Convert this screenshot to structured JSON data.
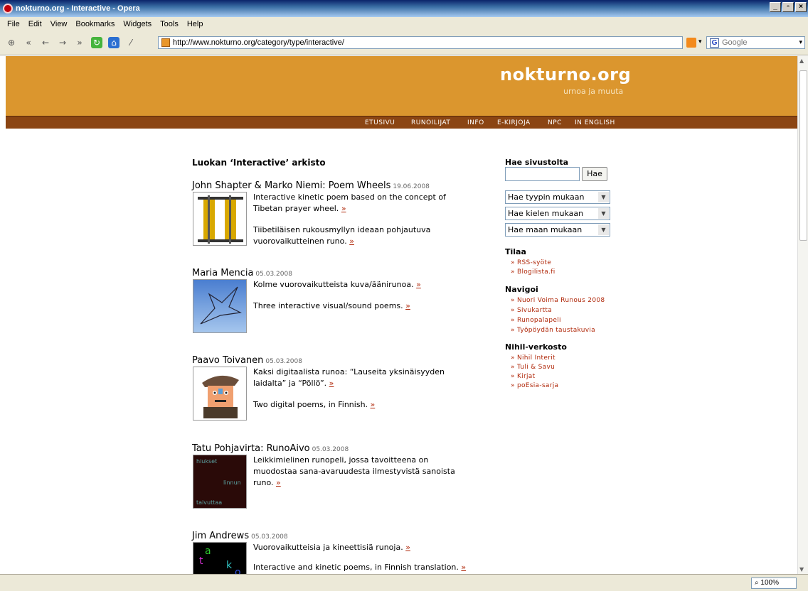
{
  "window": {
    "title": "nokturno.org - Interactive - Opera"
  },
  "menubar": {
    "items": [
      "File",
      "Edit",
      "View",
      "Bookmarks",
      "Widgets",
      "Tools",
      "Help"
    ]
  },
  "toolbar": {
    "url": "http://www.nokturno.org/category/type/interactive/",
    "search_placeholder": "Google"
  },
  "statusbar": {
    "zoom": "100%"
  },
  "site": {
    "name": "nokturno.org",
    "tagline": "urnoa ja muuta",
    "nav": [
      "ETUSIVU",
      "RUNOILIJAT",
      "INFO",
      "E-KIRJOJA",
      "NPC",
      "IN ENGLISH"
    ]
  },
  "archive": {
    "title": "Luokan ‘Interactive’ arkisto"
  },
  "posts": [
    {
      "title": "John Shapter & Marko Niemi: Poem Wheels",
      "date": "19.06.2008",
      "text1": "Interactive kinetic poem based on the concept of Tibetan prayer wheel.",
      "text2": "Tiibetiläisen rukousmyllyn ideaan pohjautuva vuorovaikutteinen runo."
    },
    {
      "title": "Maria Mencia",
      "date": "05.03.2008",
      "text1": "Kolme vuorovaikutteista kuva/äänirunoa.",
      "text2": "Three interactive visual/sound poems."
    },
    {
      "title": "Paavo Toivanen",
      "date": "05.03.2008",
      "text1": "Kaksi digitaalista runoa: “Lauseita yksinäisyyden laidalta” ja “Pöllö”.",
      "text2": "Two digital poems, in Finnish."
    },
    {
      "title": "Tatu Pohjavirta: RunoAivo",
      "date": "05.03.2008",
      "text1": "Leikkimielinen runopeli, jossa tavoitteena on muodostaa sana-avaruudesta ilmestyvistä sanoista runo.",
      "thumb_words": [
        "hiukset",
        "linnun",
        "taivuttaa"
      ]
    },
    {
      "title": "Jim Andrews",
      "date": "05.03.2008",
      "text1": "Vuorovaikutteisia ja kineettisiä runoja.",
      "text2": "Interactive and kinetic poems, in Finnish translation.",
      "thumb_letters": [
        "a",
        "t",
        "k",
        "o"
      ]
    }
  ],
  "raquo": "»",
  "sidebar": {
    "search_title": "Hae sivustolta",
    "search_button": "Hae",
    "selects": [
      "Hae tyypin mukaan",
      "Hae kielen mukaan",
      "Hae maan mukaan"
    ],
    "tilaa": {
      "title": "Tilaa",
      "links": [
        "» RSS-syöte",
        "» Blogilista.fi"
      ]
    },
    "navigoi": {
      "title": "Navigoi",
      "links": [
        "» Nuori Voima Runous 2008",
        "» Sivukartta",
        "» Runopalapeli",
        "» Työpöydän taustakuvia"
      ]
    },
    "nihil": {
      "title": "Nihil-verkosto",
      "links": [
        "» Nihil Interit",
        "» Tuli & Savu",
        "» Kirjat",
        "» poΕsia-sarja"
      ]
    }
  }
}
